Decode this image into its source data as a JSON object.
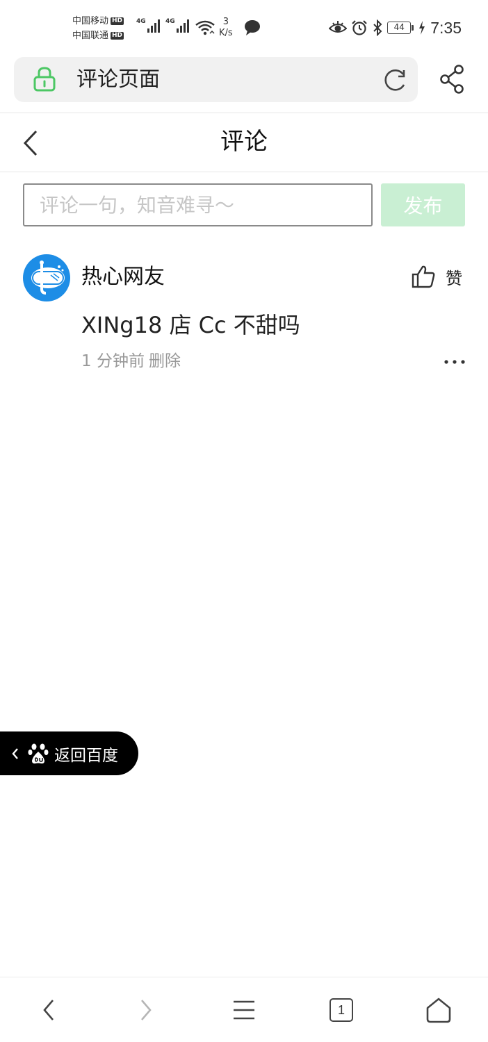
{
  "status_bar": {
    "carrier1": "中国移动",
    "carrier2": "中国联通",
    "hd_badge": "HD",
    "network1": "4G",
    "network2": "4G",
    "net_speed_value": "3",
    "net_speed_unit": "K/s",
    "battery_level": "44",
    "time": "7:35",
    "icons": [
      "signal-icon",
      "wifi-icon",
      "message-icon",
      "eye-icon",
      "alarm-icon",
      "bluetooth-icon",
      "battery-icon",
      "charging-icon"
    ]
  },
  "address_bar": {
    "title": "评论页面",
    "icons": [
      "lock-icon",
      "reload-icon",
      "share-icon"
    ]
  },
  "header": {
    "title": "评论"
  },
  "comment_form": {
    "placeholder": "评论一句，知音难寻～",
    "value": "",
    "publish_label": "发布"
  },
  "comments": [
    {
      "username": "热心网友",
      "like_label": "赞",
      "text": "XINg18 店 Cc 不甜吗",
      "time": "1 分钟前",
      "delete_label": "删除"
    }
  ],
  "back_to_baidu": {
    "label": "返回百度"
  },
  "bottom_bar": {
    "tab_count": "1"
  },
  "colors": {
    "accent_green": "#4cc764",
    "publish_disabled_bg": "#c9efd3",
    "avatar_blue": "#1d8de6",
    "muted_text": "#999999"
  }
}
